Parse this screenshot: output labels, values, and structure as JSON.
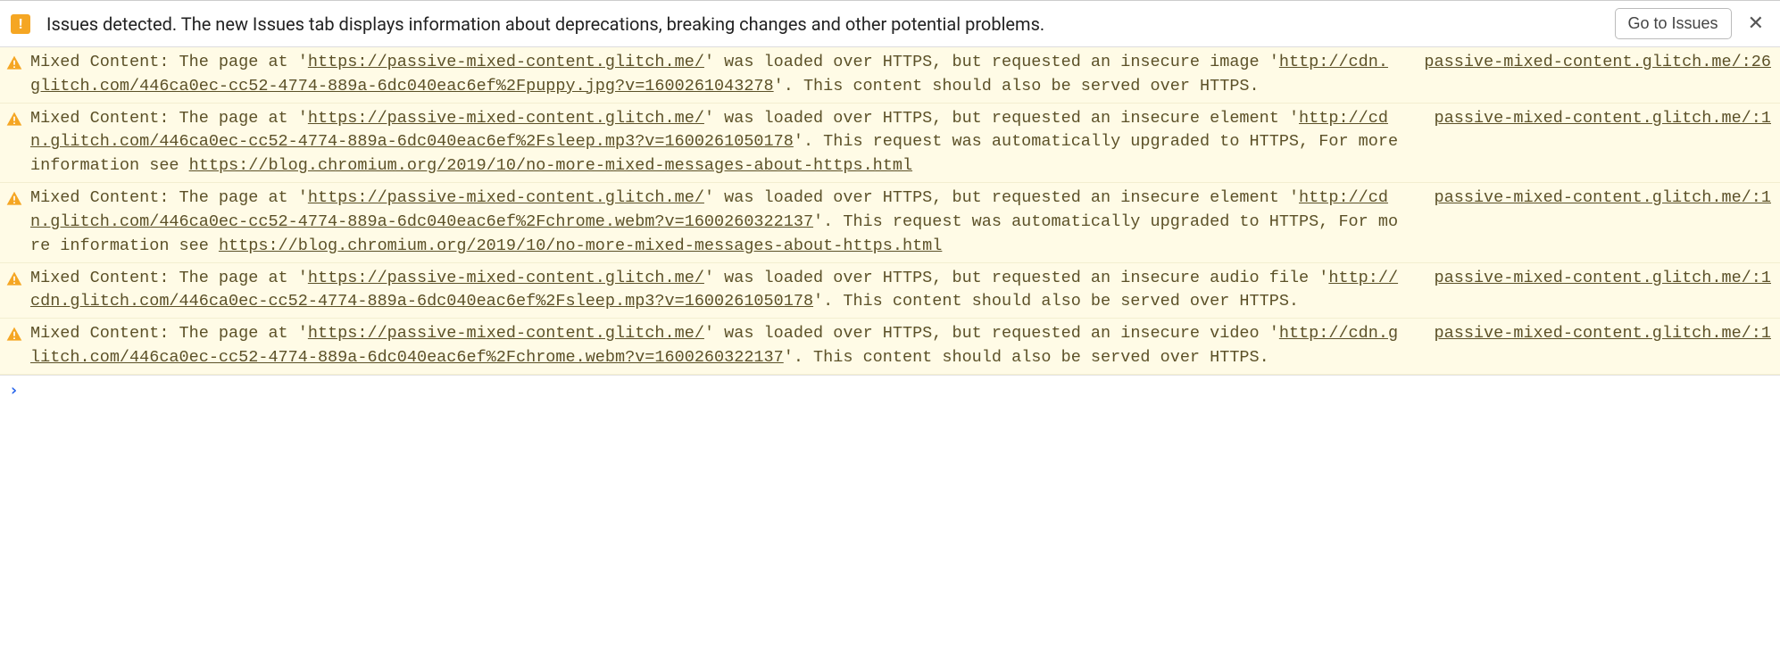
{
  "header": {
    "text": "Issues detected. The new Issues tab displays information about deprecations, breaking changes and other potential problems.",
    "button": "Go to Issues"
  },
  "warnings": [
    {
      "t1": "Mixed Content: The page at '",
      "u1": "https://passive-mixed-content.glitch.me/",
      "t2": "' was loaded over HTTPS, but requested an insecure image '",
      "u2": "http://cdn.glitch.com/446ca0ec-cc52-4774-889a-6dc040eac6ef%2Fpuppy.jpg?v=1600261043278",
      "t3": "'. This content should also be served over HTTPS.",
      "u3": "",
      "t4": "",
      "source": "passive-mixed-content.glitch.me/:26"
    },
    {
      "t1": "Mixed Content: The page at '",
      "u1": "https://passive-mixed-content.glitch.me/",
      "t2": "' was loaded over HTTPS, but requested an insecure element '",
      "u2": "http://cdn.glitch.com/446ca0ec-cc52-4774-889a-6dc040eac6ef%2Fsleep.mp3?v=1600261050178",
      "t3": "'. This request was automatically upgraded to HTTPS, For more information see ",
      "u3": "https://blog.chromium.org/2019/10/no-more-mixed-messages-about-https.html",
      "t4": "",
      "source": "passive-mixed-content.glitch.me/:1"
    },
    {
      "t1": "Mixed Content: The page at '",
      "u1": "https://passive-mixed-content.glitch.me/",
      "t2": "' was loaded over HTTPS, but requested an insecure element '",
      "u2": "http://cdn.glitch.com/446ca0ec-cc52-4774-889a-6dc040eac6ef%2Fchrome.webm?v=1600260322137",
      "t3": "'. This request was automatically upgraded to HTTPS, For more information see ",
      "u3": "https://blog.chromium.org/2019/10/no-more-mixed-messages-about-https.html",
      "t4": "",
      "source": "passive-mixed-content.glitch.me/:1"
    },
    {
      "t1": "Mixed Content: The page at '",
      "u1": "https://passive-mixed-content.glitch.me/",
      "t2": "' was loaded over HTTPS, but requested an insecure audio file '",
      "u2": "http://cdn.glitch.com/446ca0ec-cc52-4774-889a-6dc040eac6ef%2Fsleep.mp3?v=1600261050178",
      "t3": "'. This content should also be served over HTTPS.",
      "u3": "",
      "t4": "",
      "source": "passive-mixed-content.glitch.me/:1"
    },
    {
      "t1": "Mixed Content: The page at '",
      "u1": "https://passive-mixed-content.glitch.me/",
      "t2": "' was loaded over HTTPS, but requested an insecure video '",
      "u2": "http://cdn.glitch.com/446ca0ec-cc52-4774-889a-6dc040eac6ef%2Fchrome.webm?v=1600260322137",
      "t3": "'. This content should also be served over HTTPS.",
      "u3": "",
      "t4": "",
      "source": "passive-mixed-content.glitch.me/:1"
    }
  ],
  "prompt": "›"
}
